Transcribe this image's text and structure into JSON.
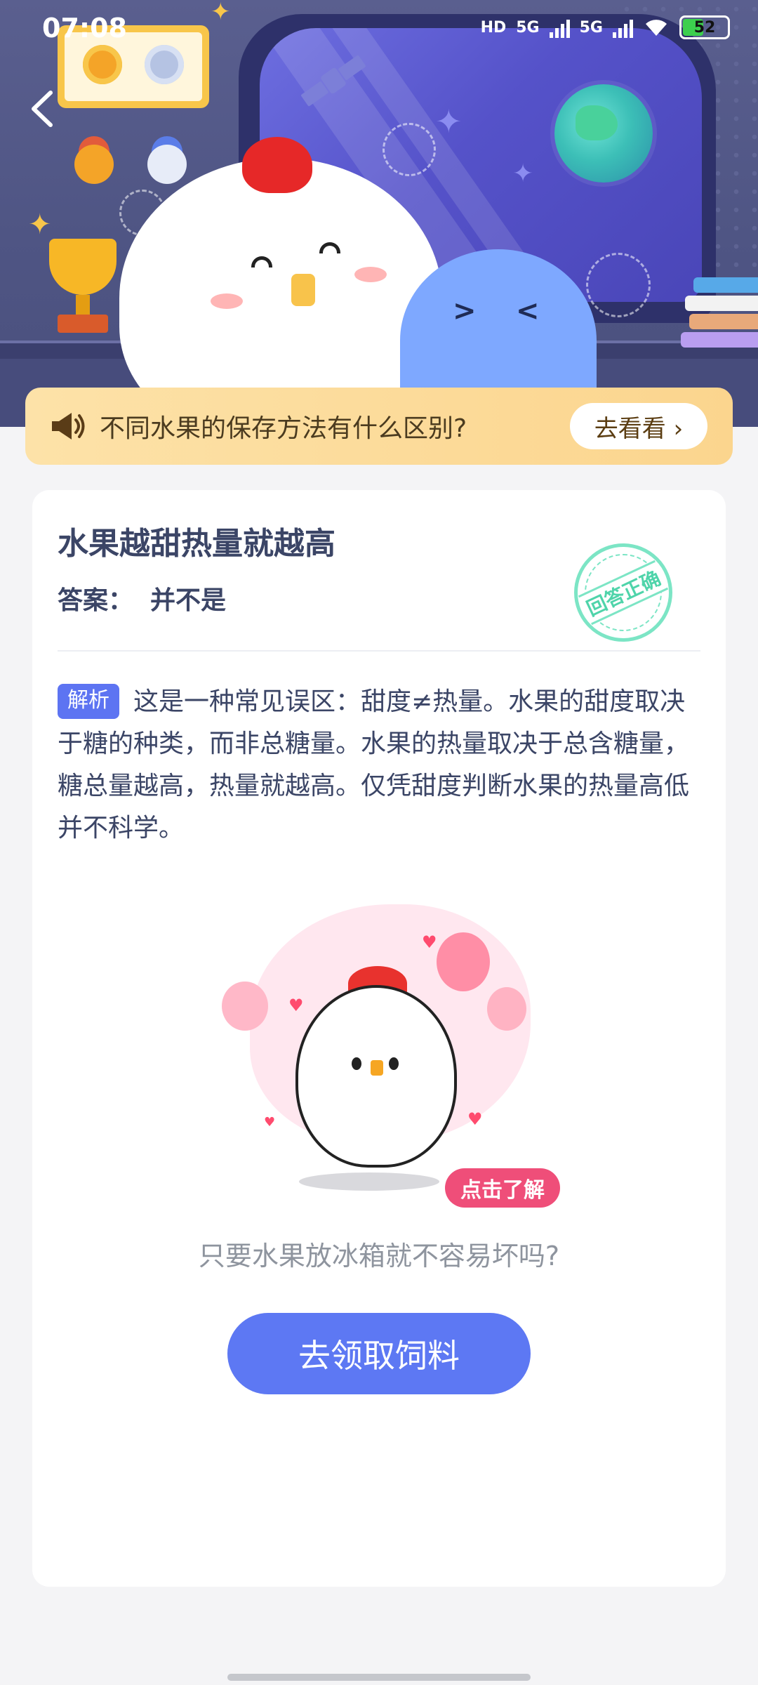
{
  "status_bar": {
    "time": "07:08",
    "hd": "HD",
    "net1": "5G",
    "net2": "5G",
    "battery": "52"
  },
  "banner": {
    "question": "不同水果的保存方法有什么区别?",
    "button": "去看看 ›"
  },
  "card": {
    "title": "水果越甜热量就越高",
    "answer_label": "答案：",
    "answer_value": "并不是",
    "stamp": "回答正确",
    "analysis_tag": "解析",
    "analysis_text": "这是一种常见误区：甜度≠热量。水果的甜度取决于糖的种类，而非总糖量。水果的热量取决于总含糖量，糖总量越高，热量就越高。仅凭甜度判断水果的热量高低并不科学。",
    "illustration_button": "点击了解",
    "next_question": "只要水果放冰箱就不容易坏吗?",
    "cta": "去领取饲料"
  },
  "icons": [
    "back-chevron-icon",
    "speaker-icon",
    "wifi-icon",
    "battery-icon"
  ],
  "colors": {
    "accent_blue": "#5d78f3",
    "banner_yellow": "#fbd58e",
    "stamp_green": "#4fd4aa",
    "pill_pink": "#ef4e79"
  }
}
